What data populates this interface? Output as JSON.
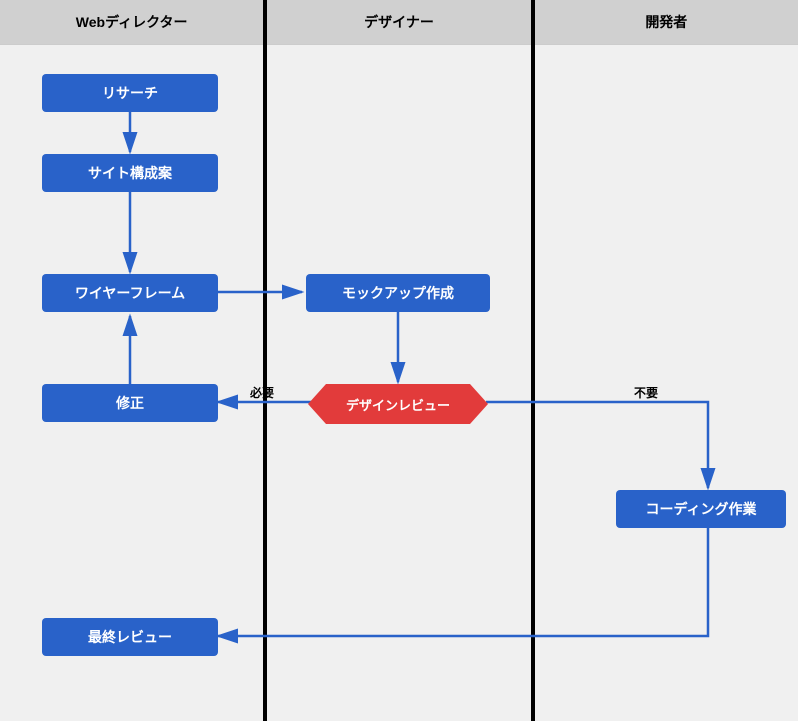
{
  "lanes": {
    "l1": "Webディレクター",
    "l2": "デザイナー",
    "l3": "開発者"
  },
  "nodes": {
    "research": "リサーチ",
    "sitemap": "サイト構成案",
    "wireframe": "ワイヤーフレーム",
    "revise": "修正",
    "mockup": "モックアップ作成",
    "review": "デザインレビュー",
    "coding": "コーディング作業",
    "final": "最終レビュー"
  },
  "edgeLabels": {
    "need": "必要",
    "notneed": "不要"
  },
  "colors": {
    "node": "#2962c9",
    "decision": "#e23b3b",
    "arrow": "#2962c9"
  }
}
